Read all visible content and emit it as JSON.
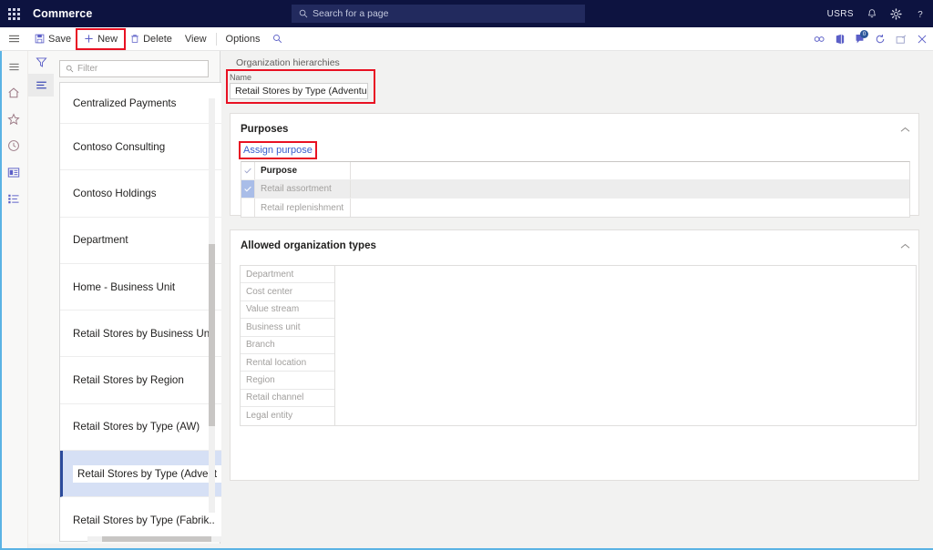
{
  "topbar": {
    "waffle_icon": "waffle-grid-icon",
    "app_title": "Commerce",
    "search_placeholder": "Search for a page",
    "search_icon": "search-icon",
    "user_initials": "USRS",
    "bell_icon": "notification-bell-icon",
    "gear_icon": "settings-gear-icon",
    "help_icon": "help-question-icon"
  },
  "commandbar": {
    "hamburger_icon": "hamburger-menu-icon",
    "items": [
      {
        "label": "Save",
        "icon": "save-floppy-icon",
        "highlighted": false
      },
      {
        "label": "New",
        "icon": "plus-icon",
        "highlighted": true
      },
      {
        "label": "Delete",
        "icon": "delete-trash-icon",
        "highlighted": false
      },
      {
        "label": "View",
        "icon": "",
        "highlighted": false
      },
      {
        "label": "Options",
        "icon": "",
        "highlighted": false
      }
    ],
    "search_icon": "search-icon",
    "right_icons": [
      {
        "name": "attach-link-icon"
      },
      {
        "name": "office-app-icon"
      },
      {
        "name": "chat-feedback-icon",
        "badge": "0"
      },
      {
        "name": "refresh-icon"
      },
      {
        "name": "popout-window-icon"
      },
      {
        "name": "close-icon"
      }
    ]
  },
  "rail": {
    "items": [
      {
        "name": "hamburger-menu-icon"
      },
      {
        "name": "home-icon"
      },
      {
        "name": "favorites-star-icon"
      },
      {
        "name": "recent-clock-icon"
      },
      {
        "name": "workspaces-icon"
      },
      {
        "name": "modules-list-icon"
      }
    ]
  },
  "listpane": {
    "tools": [
      {
        "name": "filter-funnel-icon",
        "selected": false
      },
      {
        "name": "list-view-icon",
        "selected": true
      }
    ],
    "filter_placeholder": "Filter",
    "filter_value": "",
    "filter_icon": "search-icon",
    "items": [
      {
        "label": "Centralized Payments",
        "selected": false
      },
      {
        "label": "Contoso Consulting",
        "selected": false
      },
      {
        "label": "Contoso Holdings",
        "selected": false
      },
      {
        "label": "Department",
        "selected": false
      },
      {
        "label": "Home - Business Unit",
        "selected": false
      },
      {
        "label": "Retail Stores by Business Unit",
        "selected": false
      },
      {
        "label": "Retail Stores by Region",
        "selected": false
      },
      {
        "label": "Retail Stores by Type (AW)",
        "selected": false
      },
      {
        "label": "Retail Stores by Type (Advent",
        "selected": true
      },
      {
        "label": "Retail Stores by Type (Fabrik..",
        "selected": false
      }
    ]
  },
  "main": {
    "breadcrumb": "Organization hierarchies",
    "name_label": "Name",
    "name_value": "Retail Stores by Type (Adventur...",
    "name_highlighted": true,
    "purposes": {
      "title": "Purposes",
      "collapse_icon": "chevron-up-icon",
      "assign_label": "Assign purpose",
      "assign_highlighted": true,
      "columns": [
        "Purpose"
      ],
      "check_header_icon": "check-icon",
      "rows": [
        {
          "label": "Retail assortment",
          "checked": true
        },
        {
          "label": "Retail replenishment",
          "checked": false
        }
      ]
    },
    "allowed_types": {
      "title": "Allowed organization types",
      "collapse_icon": "chevron-up-icon",
      "rows": [
        "Department",
        "Cost center",
        "Value stream",
        "Business unit",
        "Branch",
        "Rental location",
        "Region",
        "Retail channel",
        "Legal entity"
      ]
    }
  },
  "colors": {
    "topbar_bg": "#0d1340",
    "accent_link": "#3a5fcd",
    "highlight_box": "#e81123",
    "selected_row": "#d6e0f5",
    "selected_border": "#2b4a9b",
    "check_cell": "#a9bde8"
  }
}
